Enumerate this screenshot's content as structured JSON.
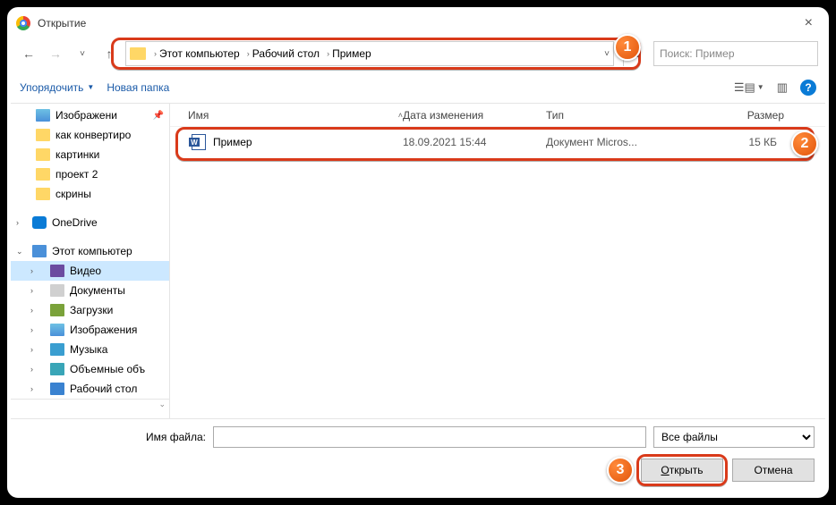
{
  "title": "Открытие",
  "nav": {
    "back": "←",
    "fwd": "→",
    "up": "↑",
    "history": "˅",
    "refresh": "↻"
  },
  "breadcrumb": [
    "Этот компьютер",
    "Рабочий стол",
    "Пример"
  ],
  "search": {
    "placeholder": "Поиск: Пример"
  },
  "toolbar": {
    "organize": "Упорядочить",
    "newfolder": "Новая папка"
  },
  "sidebar": {
    "quick": [
      {
        "label": "Изображени",
        "type": "pic",
        "pinned": true
      },
      {
        "label": "как конвертиро",
        "type": "folder"
      },
      {
        "label": "картинки",
        "type": "folder"
      },
      {
        "label": "проект 2",
        "type": "folder"
      },
      {
        "label": "скрины",
        "type": "folder"
      }
    ],
    "onedrive": "OneDrive",
    "pc": "Этот компьютер",
    "pc_items": [
      {
        "label": "Видео",
        "type": "vid",
        "selected": true
      },
      {
        "label": "Документы",
        "type": "doc"
      },
      {
        "label": "Загрузки",
        "type": "dl"
      },
      {
        "label": "Изображения",
        "type": "pic"
      },
      {
        "label": "Музыка",
        "type": "mus"
      },
      {
        "label": "Объемные объ",
        "type": "obj"
      },
      {
        "label": "Рабочий стол",
        "type": "desk"
      }
    ]
  },
  "columns": {
    "name": "Имя",
    "date": "Дата изменения",
    "type": "Тип",
    "size": "Размер"
  },
  "files": [
    {
      "name": "Пример",
      "date": "18.09.2021 15:44",
      "type": "Документ Micros...",
      "size": "15 КБ"
    }
  ],
  "footer": {
    "filename_label": "Имя файла:",
    "filename_value": "",
    "filter": "Все файлы",
    "open": "Открыть",
    "cancel": "Отмена"
  },
  "badges": {
    "one": "1",
    "two": "2",
    "three": "3"
  }
}
